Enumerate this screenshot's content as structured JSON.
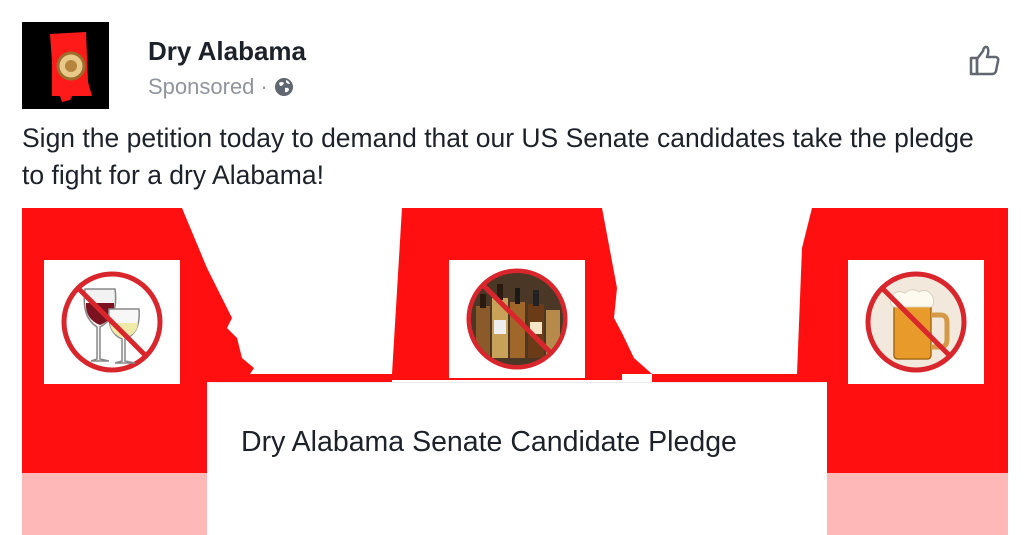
{
  "post": {
    "page_name": "Dry Alabama",
    "sponsored_label": "Sponsored",
    "separator": "·",
    "globe_icon": "globe-icon",
    "like_icon": "thumbs-up-icon",
    "message": "Sign the petition today to demand that our US Senate candidates take the pledge to fight for a dry Alabama!"
  },
  "banner": {
    "card_title": "Dry Alabama Senate Candidate Pledge",
    "icons": [
      "no-wine-icon",
      "no-liquor-icon",
      "no-beer-icon"
    ],
    "colors": {
      "red": "#ff0f0f",
      "pink": "#ffb3b3",
      "prohibition_red": "#d9262c"
    }
  }
}
